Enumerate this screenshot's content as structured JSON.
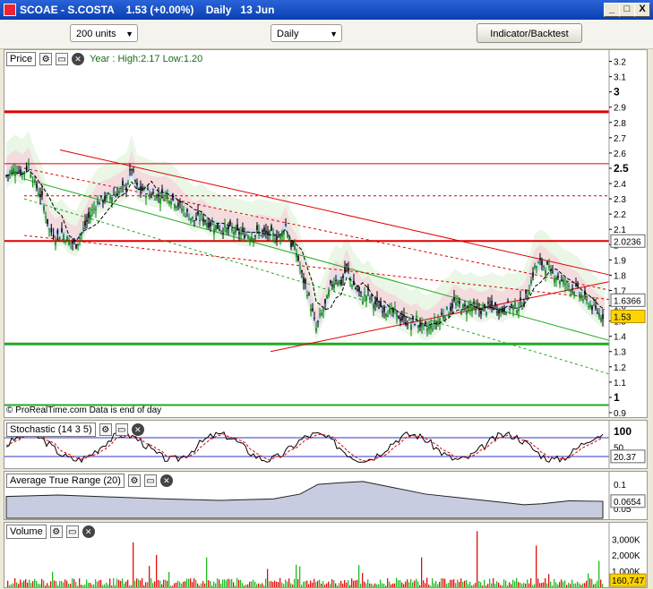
{
  "window": {
    "title": "SCOAE - S.COSTA    1.53 (+0.00%)    Daily   13 Jun",
    "controls": [
      "_",
      "□",
      "X"
    ]
  },
  "toolbar": {
    "units": "200 units",
    "period": "Daily",
    "indicator_button": "Indicator/Backtest"
  },
  "price_panel": {
    "name": "Price",
    "annotation": "Year : High:2.17 Low:1.20",
    "footer": "© ProRealTime.com  Data is end of day",
    "ticks": [
      "3.2",
      "3.1",
      "3",
      "2.9",
      "2.8",
      "2.7",
      "2.6",
      "2.5",
      "2.4",
      "2.3",
      "2.2",
      "2.1",
      "2",
      "1.9",
      "1.8",
      "1.7",
      "1.6",
      "1.5",
      "1.4",
      "1.3",
      "1.2",
      "1.1",
      "1",
      "0.9"
    ],
    "bold_ticks": [
      "3",
      "2.5",
      "1"
    ],
    "last_price": "1.53",
    "level_1": "2.0236",
    "level_2": "1.6366",
    "colors": {
      "up": "#008000",
      "down": "#000000",
      "last_bg": "#ffd400",
      "resistance": "#e00000",
      "support": "#22aa22"
    }
  },
  "stochastic_panel": {
    "name": "Stochastic (14 3 5)",
    "ticks": [
      "100",
      "50"
    ],
    "value": "20.37"
  },
  "atr_panel": {
    "name": "Average True Range (20)",
    "ticks": [
      "0.1",
      "0.05"
    ],
    "value": "0.0654"
  },
  "volume_panel": {
    "name": "Volume",
    "ticks": [
      "3,000K",
      "2,000K",
      "1,000K"
    ],
    "value": "160,747"
  },
  "chart_data": {
    "type": "candlestick",
    "title": "SCOAE - S.COSTA",
    "timeframe": "Daily",
    "ylim": [
      0.9,
      3.25
    ],
    "yearly_high": 2.17,
    "yearly_low": 1.2,
    "last": 1.53,
    "horizontal_levels": [
      2.87,
      2.53,
      2.0236,
      1.35,
      0.95
    ],
    "close_path": [
      [
        0,
        2.45
      ],
      [
        10,
        2.5
      ],
      [
        18,
        2.47
      ],
      [
        25,
        2.52
      ],
      [
        32,
        2.4
      ],
      [
        40,
        2.3
      ],
      [
        48,
        2.1
      ],
      [
        55,
        2.05
      ],
      [
        62,
        2.08
      ],
      [
        70,
        2.02
      ],
      [
        78,
        2.0
      ],
      [
        86,
        2.1
      ],
      [
        94,
        2.2
      ],
      [
        102,
        2.28
      ],
      [
        110,
        2.3
      ],
      [
        118,
        2.32
      ],
      [
        126,
        2.35
      ],
      [
        134,
        2.38
      ],
      [
        140,
        2.5
      ],
      [
        146,
        2.37
      ],
      [
        154,
        2.35
      ],
      [
        162,
        2.33
      ],
      [
        170,
        2.32
      ],
      [
        178,
        2.33
      ],
      [
        186,
        2.3
      ],
      [
        194,
        2.25
      ],
      [
        202,
        2.2
      ],
      [
        210,
        2.16
      ],
      [
        218,
        2.18
      ],
      [
        226,
        2.14
      ],
      [
        234,
        2.12
      ],
      [
        242,
        2.1
      ],
      [
        250,
        2.1
      ],
      [
        258,
        2.08
      ],
      [
        266,
        2.07
      ],
      [
        274,
        2.06
      ],
      [
        282,
        2.08
      ],
      [
        290,
        2.07
      ],
      [
        298,
        2.06
      ],
      [
        306,
        2.05
      ],
      [
        312,
        2.13
      ],
      [
        318,
        2.0
      ],
      [
        324,
        1.95
      ],
      [
        330,
        1.8
      ],
      [
        336,
        1.7
      ],
      [
        342,
        1.55
      ],
      [
        346,
        1.45
      ],
      [
        350,
        1.52
      ],
      [
        356,
        1.6
      ],
      [
        362,
        1.72
      ],
      [
        368,
        1.78
      ],
      [
        374,
        1.75
      ],
      [
        380,
        1.85
      ],
      [
        386,
        1.75
      ],
      [
        392,
        1.7
      ],
      [
        398,
        1.65
      ],
      [
        404,
        1.68
      ],
      [
        410,
        1.62
      ],
      [
        416,
        1.6
      ],
      [
        422,
        1.58
      ],
      [
        428,
        1.56
      ],
      [
        434,
        1.55
      ],
      [
        440,
        1.52
      ],
      [
        446,
        1.5
      ],
      [
        452,
        1.48
      ],
      [
        458,
        1.5
      ],
      [
        464,
        1.46
      ],
      [
        470,
        1.45
      ],
      [
        476,
        1.47
      ],
      [
        482,
        1.5
      ],
      [
        488,
        1.55
      ],
      [
        494,
        1.57
      ],
      [
        500,
        1.62
      ],
      [
        506,
        1.6
      ],
      [
        512,
        1.58
      ],
      [
        518,
        1.6
      ],
      [
        524,
        1.58
      ],
      [
        530,
        1.57
      ],
      [
        536,
        1.58
      ],
      [
        542,
        1.6
      ],
      [
        548,
        1.58
      ],
      [
        554,
        1.57
      ],
      [
        560,
        1.6
      ],
      [
        566,
        1.59
      ],
      [
        572,
        1.6
      ],
      [
        578,
        1.62
      ],
      [
        584,
        1.72
      ],
      [
        590,
        1.85
      ],
      [
        596,
        1.88
      ],
      [
        602,
        1.86
      ],
      [
        608,
        1.82
      ],
      [
        614,
        1.8
      ],
      [
        620,
        1.76
      ],
      [
        626,
        1.74
      ],
      [
        632,
        1.72
      ],
      [
        638,
        1.7
      ],
      [
        644,
        1.65
      ],
      [
        650,
        1.62
      ],
      [
        656,
        1.58
      ],
      [
        662,
        1.55
      ],
      [
        668,
        1.53
      ]
    ],
    "stochastic_last": 20.37,
    "atr_last": 0.0654,
    "volume_last": 160747
  }
}
